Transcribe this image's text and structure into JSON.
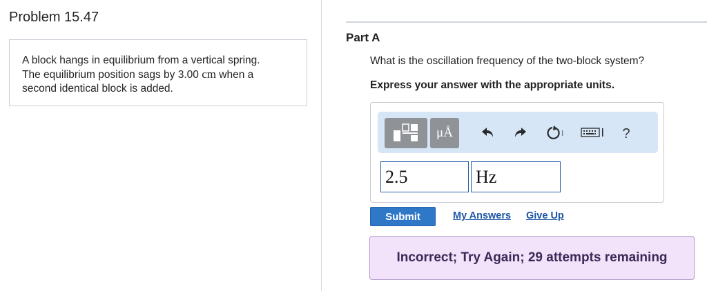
{
  "problem": {
    "title": "Problem 15.47",
    "statement": {
      "line1": "A block hangs in equilibrium from a vertical spring.",
      "line2_prefix": "The equilibrium position sags by ",
      "line2_value": "3.00",
      "line2_unit": "cm",
      "line2_suffix": " when a",
      "line3": "second identical block is added."
    }
  },
  "part": {
    "label": "Part A",
    "question": "What is the oscillation frequency of the two-block system?",
    "instruction": "Express your answer with the appropriate units."
  },
  "toolbar": {
    "units_symbol": "μÅ",
    "icons": [
      "templates-icon",
      "units-icon",
      "undo-icon",
      "redo-icon",
      "reset-icon",
      "keyboard-icon",
      "help-icon"
    ],
    "help_label": "?"
  },
  "answer": {
    "value": "2.5",
    "unit": "Hz"
  },
  "actions": {
    "submit_label": "Submit",
    "my_answers_label": "My Answers",
    "give_up_label": "Give Up"
  },
  "feedback": {
    "message": "Incorrect; Try Again; 29 attempts remaining"
  },
  "colors": {
    "accent": "#2f77c7",
    "toolbar_bg": "#d6e6f7",
    "feedback_bg": "#f2e2fa"
  }
}
